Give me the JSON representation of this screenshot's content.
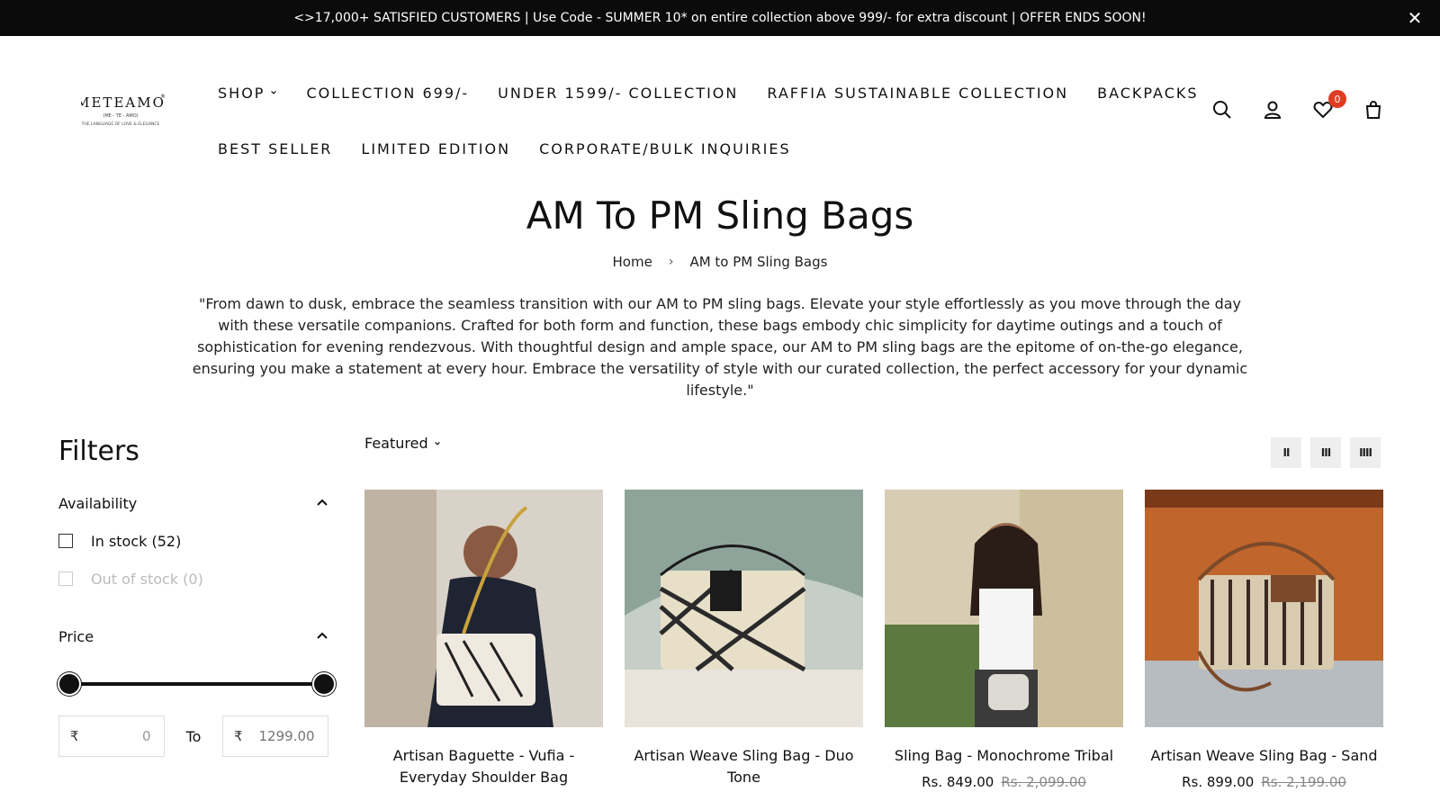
{
  "announcement": {
    "text": "<>17,000+ SATISFIED CUSTOMERS | Use Code - SUMMER 10* on entire collection above 999/- for extra discount | OFFER ENDS SOON!",
    "close_icon": "close-icon"
  },
  "logo": {
    "brand": "METEAMO",
    "sub": "(ME - TE - AMO)",
    "tagline": "THE LANGUAGE OF LOVE & ELEGANCE"
  },
  "nav": {
    "row1": [
      "SHOP",
      "COLLECTION 699/-",
      "UNDER 1599/- COLLECTION",
      "RAFFIA SUSTAINABLE COLLECTION",
      "BACKPACKS"
    ],
    "row2": [
      "BEST SELLER",
      "LIMITED EDITION",
      "CORPORATE/BULK INQUIRIES"
    ]
  },
  "header_icons": {
    "wishlist_count": "0"
  },
  "page": {
    "title": "AM To PM Sling Bags",
    "breadcrumb_home": "Home",
    "breadcrumb_current": "AM to PM Sling Bags",
    "description": "\"From dawn to dusk, embrace the seamless transition with our AM to PM sling bags. Elevate your style effortlessly as you move through the day with these versatile companions. Crafted for both form and function, these bags embody chic simplicity for daytime outings and a touch of sophistication for evening rendezvous. With thoughtful design and ample space, our AM to PM sling bags are the epitome of on-the-go elegance, ensuring you make a statement at every hour. Embrace the versatility of style with our curated collection, the perfect accessory for your dynamic lifestyle.\""
  },
  "filters": {
    "title": "Filters",
    "availability_label": "Availability",
    "in_stock": "In stock (52)",
    "out_of_stock": "Out of stock (0)",
    "price_label": "Price",
    "currency": "₹",
    "min_value": "0",
    "max_placeholder": "1299.00",
    "to_label": "To"
  },
  "sort": {
    "selected": "Featured"
  },
  "products": [
    {
      "name": "Artisan Baguette - Vufia - Everyday Shoulder Bag",
      "price": "",
      "old_price": ""
    },
    {
      "name": "Artisan Weave Sling Bag - Duo Tone",
      "price": "",
      "old_price": ""
    },
    {
      "name": "Sling Bag - Monochrome Tribal",
      "price": "Rs. 849.00",
      "old_price": "Rs. 2,099.00"
    },
    {
      "name": "Artisan Weave Sling Bag - Sand",
      "price": "Rs. 899.00",
      "old_price": "Rs. 2,199.00"
    }
  ],
  "colors": {
    "accent_badge": "#e03c24",
    "bar_bg": "#0b0b0b"
  }
}
